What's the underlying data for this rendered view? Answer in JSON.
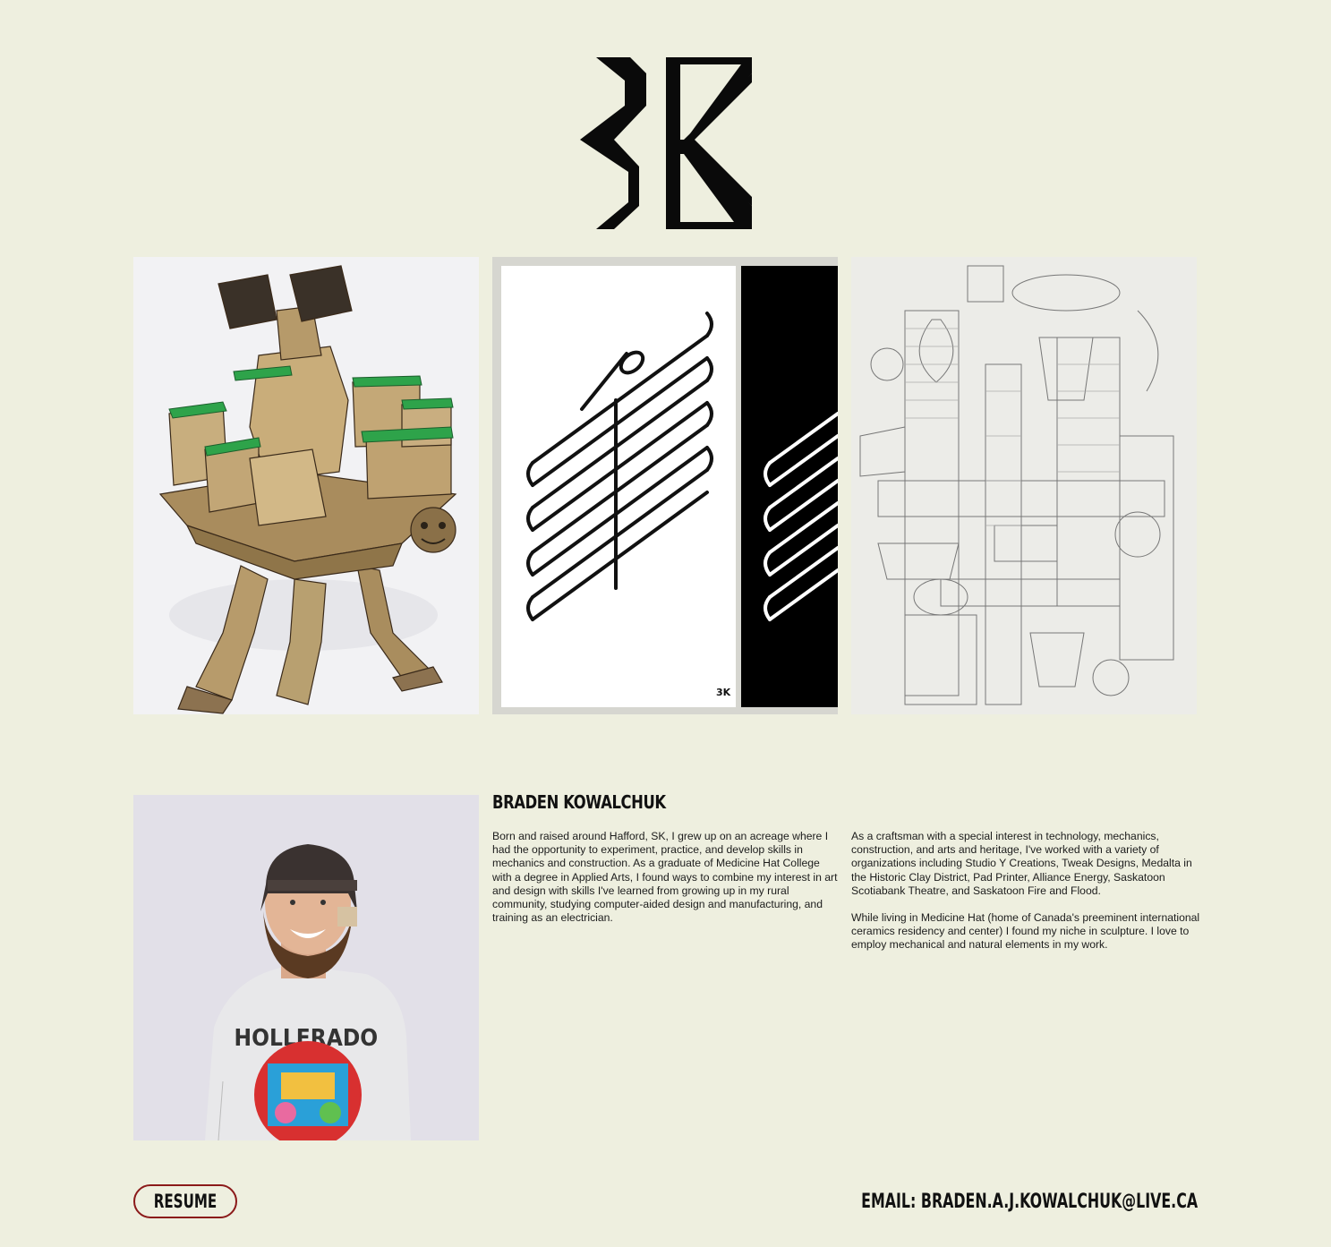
{
  "brand": {
    "logo_icon": "sk-monogram-logo"
  },
  "gallery": {
    "items": [
      {
        "icon": "cardboard-sculpture-image"
      },
      {
        "icon": "trumpet-coil-poster-image"
      },
      {
        "icon": "pencil-machine-drawing-image"
      }
    ]
  },
  "about": {
    "portrait_icon": "artist-portrait-image",
    "name": "BRADEN KOWALCHUK",
    "paragraph_1": "Born and raised around Hafford, SK, I grew up on an acreage where I had the opportunity to experiment, practice, and develop skills in mechanics and construction. As a graduate of Medicine Hat College with a degree in Applied Arts, I found ways to combine my interest in art and design with skills I've learned from growing up in my rural community, studying computer-aided design and manufacturing, and training as an electrician.",
    "paragraph_2": "As a craftsman with a special interest in technology, mechanics, construction, and arts and heritage, I've worked with a variety of organizations including Studio Y Creations, Tweak Designs, Medalta in the Historic Clay District, Pad Printer, Alliance Energy, Saskatoon Scotiabank Theatre, and Saskatoon Fire and Flood.",
    "paragraph_3": "While living in Medicine Hat (home of Canada's preeminent international ceramics residency and center) I found my niche in sculpture. I love to employ mechanical and natural elements in my work."
  },
  "footer": {
    "resume_label": "RESUME",
    "email_text": "EMAIL: BRADEN.A.J.KOWALCHUK@LIVE.CA"
  },
  "colors": {
    "background": "#eeefdf",
    "accent": "#8b1a1a",
    "text": "#111111"
  }
}
